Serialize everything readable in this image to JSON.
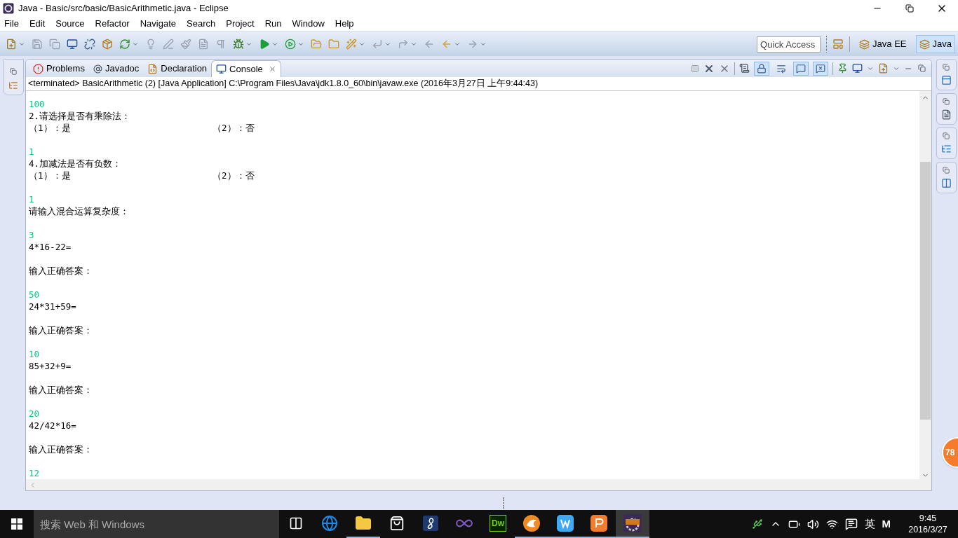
{
  "window": {
    "title": "Java - Basic/src/basic/BasicArithmetic.java - Eclipse"
  },
  "menu": [
    "File",
    "Edit",
    "Source",
    "Refactor",
    "Navigate",
    "Search",
    "Project",
    "Run",
    "Window",
    "Help"
  ],
  "quick_access": {
    "placeholder": "Quick Access"
  },
  "perspectives": [
    {
      "label": "Java EE",
      "selected": false
    },
    {
      "label": "Java",
      "selected": true
    }
  ],
  "tabs": [
    {
      "label": "Problems",
      "kind": "problems",
      "selected": false
    },
    {
      "label": "Javadoc",
      "kind": "javadoc",
      "selected": false
    },
    {
      "label": "Declaration",
      "kind": "declaration",
      "selected": false
    },
    {
      "label": "Console",
      "kind": "console",
      "selected": true
    }
  ],
  "console_toggles": [
    {
      "kind": "scroll-lock",
      "selected": true
    },
    {
      "kind": "word-wrap",
      "selected": false
    },
    {
      "kind": "stdout",
      "selected": true
    },
    {
      "kind": "stderr",
      "selected": true
    }
  ],
  "console": {
    "status": "<terminated> BasicArithmetic (2) [Java Application] C:\\Program Files\\Java\\jdk1.8.0_60\\bin\\javaw.exe (2016年3月27日 上午9:44:43)",
    "lines": [
      {
        "kind": "input",
        "text": "100"
      },
      {
        "kind": "output",
        "text": "2.请选择是否有乘除法："
      },
      {
        "kind": "options",
        "text": "（1）：是",
        "text_2": "（2）：否"
      },
      {
        "kind": "blank"
      },
      {
        "kind": "input",
        "text": "1"
      },
      {
        "kind": "output",
        "text": "4.加减法是否有负数："
      },
      {
        "kind": "options",
        "text": "（1）：是",
        "text_2": "（2）：否"
      },
      {
        "kind": "blank"
      },
      {
        "kind": "input",
        "text": "1"
      },
      {
        "kind": "output",
        "text": "请输入混合运算复杂度："
      },
      {
        "kind": "blank"
      },
      {
        "kind": "input",
        "text": "3"
      },
      {
        "kind": "output",
        "text": "4*16-22="
      },
      {
        "kind": "blank"
      },
      {
        "kind": "output",
        "text": "输入正确答案："
      },
      {
        "kind": "blank"
      },
      {
        "kind": "input",
        "text": "50"
      },
      {
        "kind": "output",
        "text": "24*31+59="
      },
      {
        "kind": "blank"
      },
      {
        "kind": "output",
        "text": "输入正确答案："
      },
      {
        "kind": "blank"
      },
      {
        "kind": "input",
        "text": "10"
      },
      {
        "kind": "output",
        "text": "85+32+9="
      },
      {
        "kind": "blank"
      },
      {
        "kind": "output",
        "text": "输入正确答案："
      },
      {
        "kind": "blank"
      },
      {
        "kind": "input",
        "text": "20"
      },
      {
        "kind": "output",
        "text": "42/42*16="
      },
      {
        "kind": "blank"
      },
      {
        "kind": "output",
        "text": "输入正确答案："
      },
      {
        "kind": "blank"
      },
      {
        "kind": "input",
        "text": "12"
      }
    ]
  },
  "floating_badge": "78",
  "taskbar": {
    "search_placeholder": "搜索 Web 和 Windows",
    "apps": [
      {
        "kind": "task-view",
        "running": false,
        "active": false
      },
      {
        "kind": "edge",
        "running": false,
        "active": false
      },
      {
        "kind": "explorer",
        "running": true,
        "active": false
      },
      {
        "kind": "store",
        "running": false,
        "active": false
      },
      {
        "kind": "eight",
        "running": false,
        "active": false
      },
      {
        "kind": "infinity",
        "running": false,
        "active": false
      },
      {
        "kind": "dreamweaver",
        "label": "Dw",
        "running": false,
        "active": false
      },
      {
        "kind": "browser",
        "running": true,
        "active": false
      },
      {
        "kind": "writer",
        "running": true,
        "active": false
      },
      {
        "kind": "presentation",
        "running": true,
        "active": false
      },
      {
        "kind": "ide",
        "running": true,
        "active": true
      }
    ],
    "ime": "英",
    "ime_mode": "M",
    "time": "9:45",
    "date": "2016/3/27"
  }
}
